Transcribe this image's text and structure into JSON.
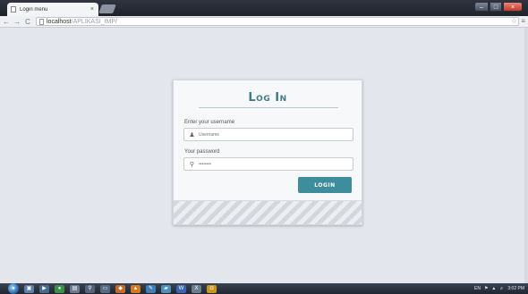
{
  "browser": {
    "tab_title": "Login menu",
    "tab_close": "×",
    "url_host": "localhost",
    "url_path": "/APLIKASI_IMP/",
    "back_glyph": "←",
    "forward_glyph": "→",
    "reload_glyph": "C",
    "star_glyph": "☆",
    "menu_glyph": "≡",
    "window_min": "–",
    "window_max": "□",
    "window_close": "×"
  },
  "login": {
    "title": "Log In",
    "username_label": "Enter your username",
    "username_placeholder": "Username",
    "password_label": "Your password",
    "password_placeholder": "••••••••",
    "login_button": "LOGIN",
    "accent_color": "#3d8d9c"
  },
  "taskbar": {
    "tray_lang": "EN",
    "tray_time": "3:02 PM",
    "tasks": [
      {
        "icon": "file-explorer-icon",
        "glyph": "▣",
        "color": "#5a7fa8"
      },
      {
        "icon": "media-player-icon",
        "glyph": "▶",
        "color": "#4a6a8c"
      },
      {
        "icon": "chrome-icon",
        "glyph": "●",
        "color": "#3b8f4a"
      },
      {
        "icon": "notepad-icon",
        "glyph": "▤",
        "color": "#6b7b91"
      },
      {
        "icon": "search-icon",
        "glyph": "⚲",
        "color": "#54657b"
      },
      {
        "icon": "window-icon",
        "glyph": "▭",
        "color": "#566a84"
      },
      {
        "icon": "app-icon",
        "glyph": "◆",
        "color": "#c46a2b"
      },
      {
        "icon": "vlc-icon",
        "glyph": "▲",
        "color": "#d57a1e"
      },
      {
        "icon": "paint-icon",
        "glyph": "✎",
        "color": "#3f7fb5"
      },
      {
        "icon": "folder-icon",
        "glyph": "▰",
        "color": "#4f8fc0"
      },
      {
        "icon": "word-icon",
        "glyph": "W",
        "color": "#3a63b0"
      },
      {
        "icon": "excel-icon",
        "glyph": "X",
        "color": "#6a7d8f"
      },
      {
        "icon": "tool-icon",
        "glyph": "◘",
        "color": "#c9961f"
      }
    ]
  }
}
